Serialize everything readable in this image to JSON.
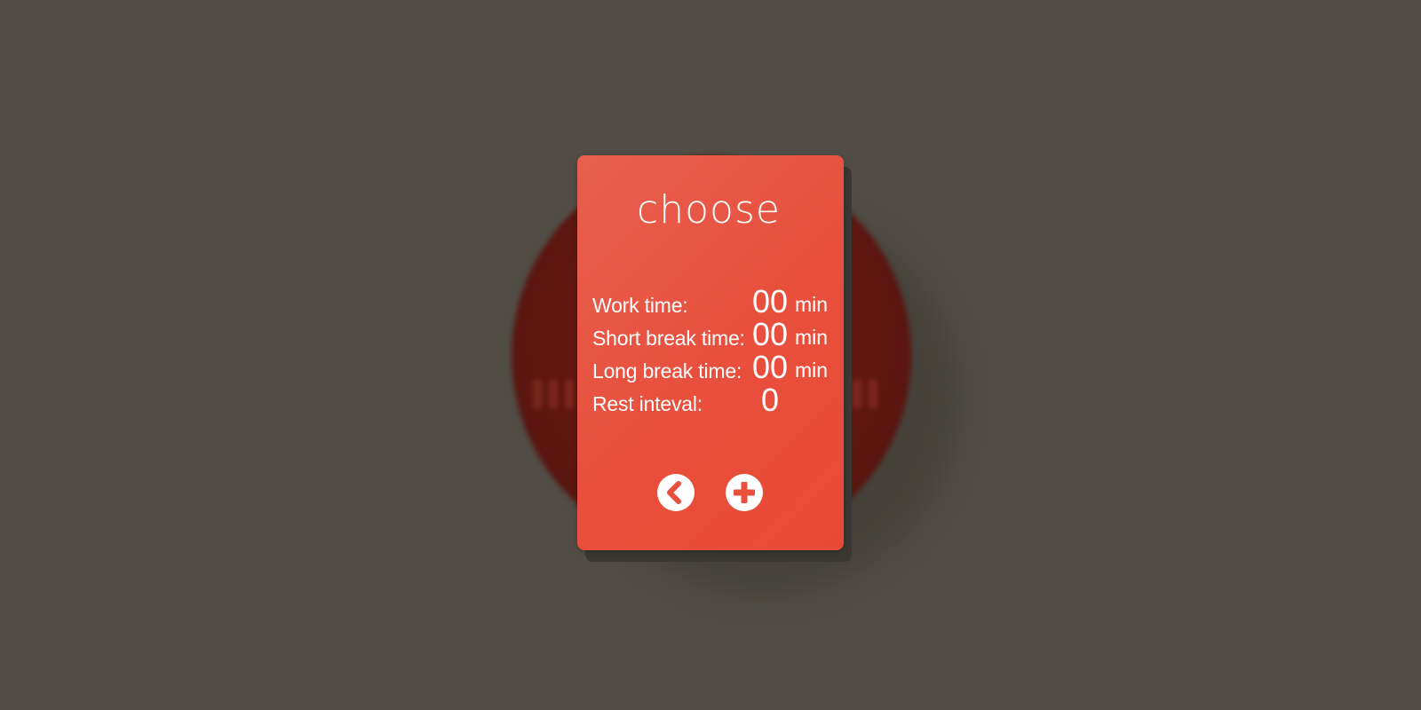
{
  "dialog": {
    "title": "choose",
    "rows": [
      {
        "label": "Work time:",
        "value": "00",
        "unit": "min"
      },
      {
        "label": "Short break time:",
        "value": "00",
        "unit": "min"
      },
      {
        "label": "Long break time:",
        "value": "00",
        "unit": "min"
      },
      {
        "label": "Rest inteval:",
        "value": "0",
        "unit": ""
      }
    ],
    "actions": {
      "back_icon": "chevron-left-icon",
      "add_icon": "plus-icon"
    }
  },
  "colors": {
    "background": "#514d46",
    "card": "#e84f3c",
    "card_shadow": "#3b3834",
    "text": "#ffffff",
    "icon_fill": "#e84f3c"
  }
}
